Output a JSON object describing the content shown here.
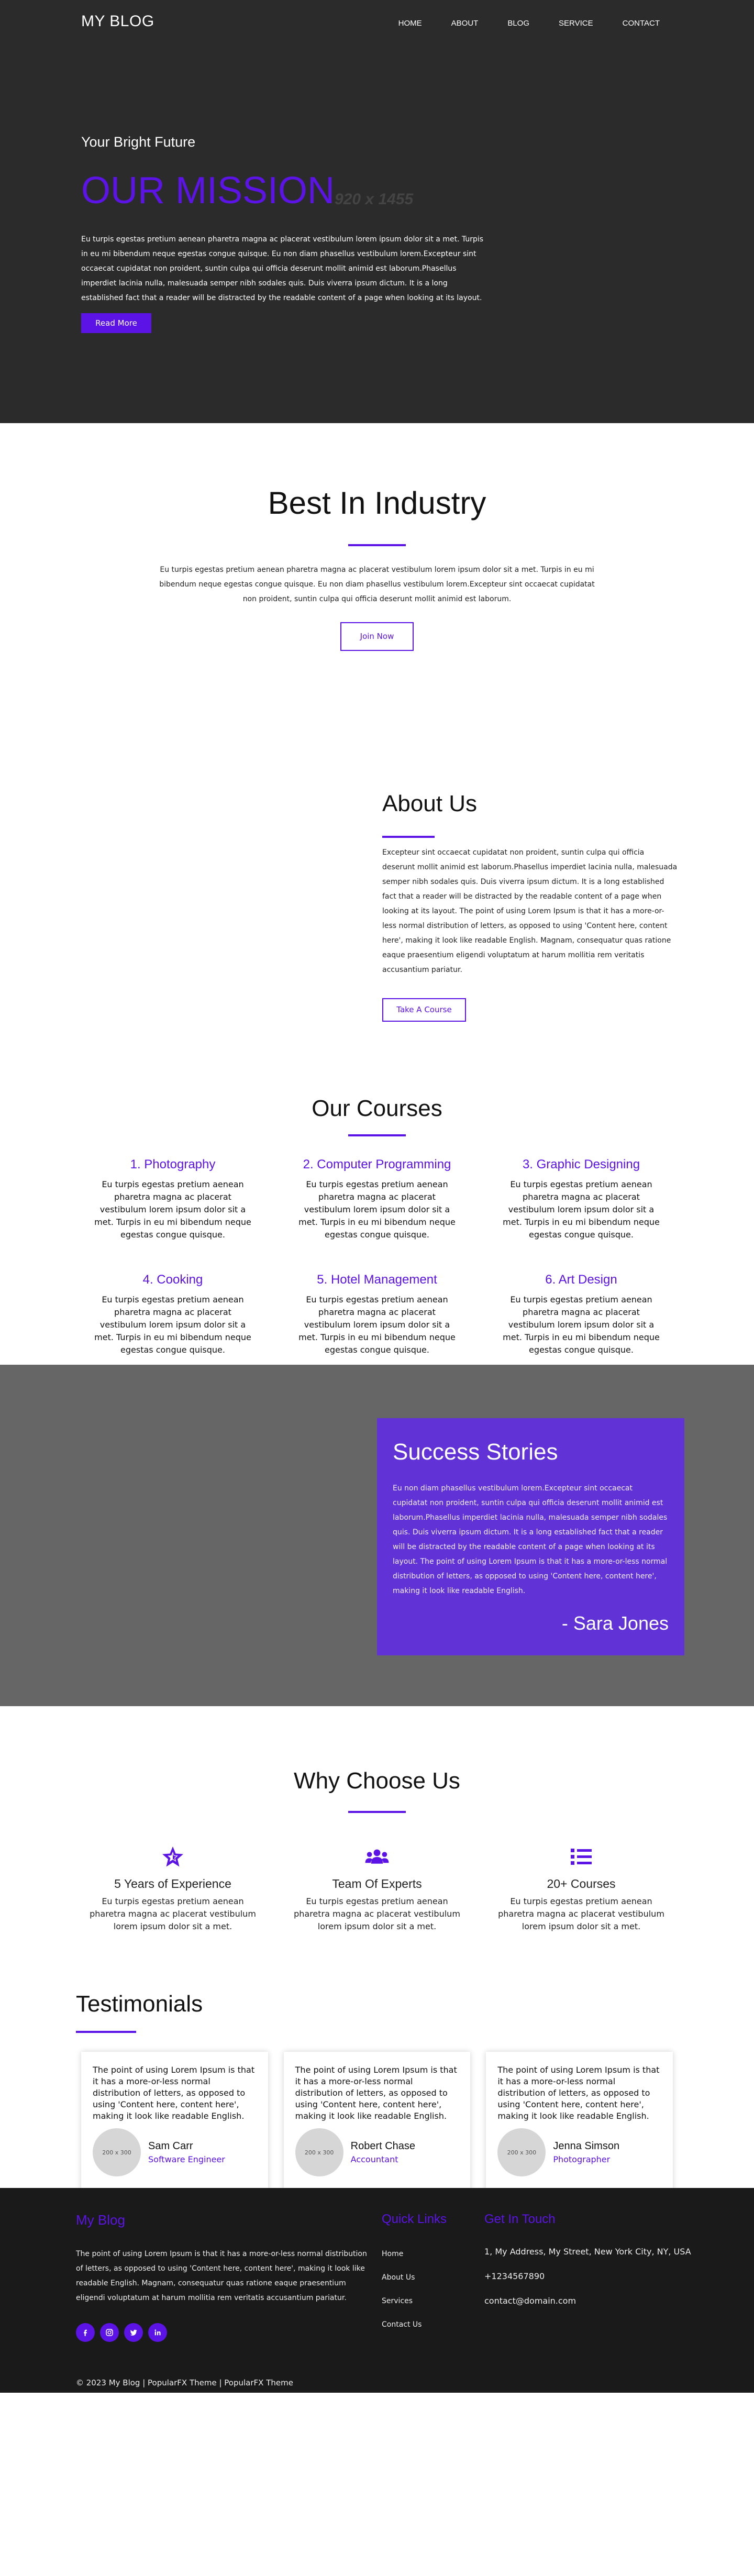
{
  "header": {
    "site_title": "MY BLOG",
    "nav": [
      "HOME",
      "ABOUT",
      "BLOG",
      "SERVICE",
      "CONTACT"
    ]
  },
  "hero": {
    "subtitle": "Your Bright Future",
    "title": "OUR MISSION",
    "image_placeholder": "920 x 1455",
    "text": "Eu turpis egestas pretium aenean pharetra magna ac placerat vestibulum lorem ipsum dolor sit a met. Turpis in eu mi bibendum neque egestas congue quisque. Eu non diam phasellus vestibulum lorem.Excepteur sint occaecat cupidatat non proident, suntin culpa qui officia deserunt mollit animid est laborum.Phasellus imperdiet lacinia nulla, malesuada semper nibh sodales quis. Duis viverra ipsum dictum. It is a long established fact that a reader will be distracted by the readable content of a page when looking at its layout.",
    "button": "Read More"
  },
  "best": {
    "title": "Best In Industry",
    "text": "Eu turpis egestas pretium aenean pharetra magna ac placerat vestibulum lorem ipsum dolor sit a met. Turpis in eu mi bibendum neque egestas congue quisque. Eu non diam phasellus vestibulum lorem.Excepteur sint occaecat cupidatat non proident, suntin culpa qui officia deserunt mollit animid est laborum.",
    "button": "Join Now"
  },
  "about": {
    "title": "About Us",
    "text": "Excepteur sint occaecat cupidatat non proident, suntin culpa qui officia deserunt mollit animid est laborum.Phasellus imperdiet lacinia nulla, malesuada semper nibh sodales quis. Duis viverra ipsum dictum. It is a long established fact that a reader will be distracted by the readable content of a page when looking at its layout. The point of using Lorem Ipsum is that it has a more-or-less normal distribution of letters, as opposed to using 'Content here, content here', making it look like readable English. Magnam, consequatur quas ratione eaque praesentium eligendi voluptatum at harum mollitia rem veritatis accusantium pariatur.",
    "button": "Take A Course"
  },
  "courses": {
    "title": "Our Courses",
    "items": [
      {
        "title": "1. Photography",
        "text": "Eu turpis egestas pretium aenean pharetra magna ac placerat vestibulum lorem ipsum dolor sit a met. Turpis in eu mi bibendum neque egestas congue quisque."
      },
      {
        "title": "2. Computer Programming",
        "text": "Eu turpis egestas pretium aenean pharetra magna ac placerat vestibulum lorem ipsum dolor sit a met. Turpis in eu mi bibendum neque egestas congue quisque."
      },
      {
        "title": "3. Graphic Designing",
        "text": "Eu turpis egestas pretium aenean pharetra magna ac placerat vestibulum lorem ipsum dolor sit a met. Turpis in eu mi bibendum neque egestas congue quisque."
      },
      {
        "title": "4. Cooking",
        "text": "Eu turpis egestas pretium aenean pharetra magna ac placerat vestibulum lorem ipsum dolor sit a met. Turpis in eu mi bibendum neque egestas congue quisque."
      },
      {
        "title": "5. Hotel Management",
        "text": "Eu turpis egestas pretium aenean pharetra magna ac placerat vestibulum lorem ipsum dolor sit a met. Turpis in eu mi bibendum neque egestas congue quisque."
      },
      {
        "title": "6. Art Design",
        "text": "Eu turpis egestas pretium aenean pharetra magna ac placerat vestibulum lorem ipsum dolor sit a met. Turpis in eu mi bibendum neque egestas congue quisque."
      }
    ]
  },
  "success": {
    "title": "Success Stories",
    "text": "Eu non diam phasellus vestibulum lorem.Excepteur sint occaecat cupidatat non proident, suntin culpa qui officia deserunt mollit animid est laborum.Phasellus imperdiet lacinia nulla, malesuada semper nibh sodales quis. Duis viverra ipsum dictum. It is a long established fact that a reader will be distracted by the readable content of a page when looking at its layout. The point of using Lorem Ipsum is that it has a more-or-less normal distribution of letters, as opposed to using 'Content here, content here', making it look like readable English.",
    "author": "- Sara Jones"
  },
  "why": {
    "title": "Why Choose Us",
    "items": [
      {
        "icon": "star-icon",
        "title": "5 Years of Experience",
        "text": "Eu turpis egestas pretium aenean pharetra magna ac placerat vestibulum lorem ipsum dolor sit a met."
      },
      {
        "icon": "users-icon",
        "title": "Team Of Experts",
        "text": "Eu turpis egestas pretium aenean pharetra magna ac placerat vestibulum lorem ipsum dolor sit a met."
      },
      {
        "icon": "list-icon",
        "title": "20+ Courses",
        "text": "Eu turpis egestas pretium aenean pharetra magna ac placerat vestibulum lorem ipsum dolor sit a met."
      }
    ]
  },
  "testimonials": {
    "title": "Testimonials",
    "items": [
      {
        "text": "The point of using Lorem Ipsum is that it has a more-or-less normal distribution of letters, as opposed to using 'Content here, content here', making it look like readable English.",
        "avatar": "200 x 300",
        "name": "Sam Carr",
        "role": "Software Engineer"
      },
      {
        "text": "The point of using Lorem Ipsum is that it has a more-or-less normal distribution of letters, as opposed to using 'Content here, content here', making it look like readable English.",
        "avatar": "200 x 300",
        "name": "Robert Chase",
        "role": "Accountant"
      },
      {
        "text": "The point of using Lorem Ipsum is that it has a more-or-less normal distribution of letters, as opposed to using 'Content here, content here', making it look like readable English.",
        "avatar": "200 x 300",
        "name": "Jenna Simson",
        "role": "Photographer"
      }
    ]
  },
  "footer": {
    "title": "My Blog",
    "about": "The point of using Lorem Ipsum is that it has a more-or-less normal distribution of letters, as opposed to using 'Content here, content here', making it look like readable English. Magnam, consequatur quas ratione eaque praesentium eligendi voluptatum at harum mollitia rem veritatis accusantium pariatur.",
    "socials": [
      "facebook-icon",
      "instagram-icon",
      "twitter-icon",
      "linkedin-icon"
    ],
    "links_title": "Quick Links",
    "links": [
      "Home",
      "About Us",
      "Services",
      "Contact Us"
    ],
    "contact_title": "Get In Touch",
    "contact": [
      "1, My Address, My Street, New York City, NY, USA",
      "+1234567890",
      "contact@domain.com"
    ],
    "copyright": "© 2023 My Blog | PopularFX Theme | PopularFX Theme"
  },
  "colors": {
    "accent": "#5b13e6",
    "hero_bg": "#2b2b2b",
    "success_bg": "#666666",
    "success_box": "#6133d6",
    "footer_bg": "#1a1a1a"
  }
}
